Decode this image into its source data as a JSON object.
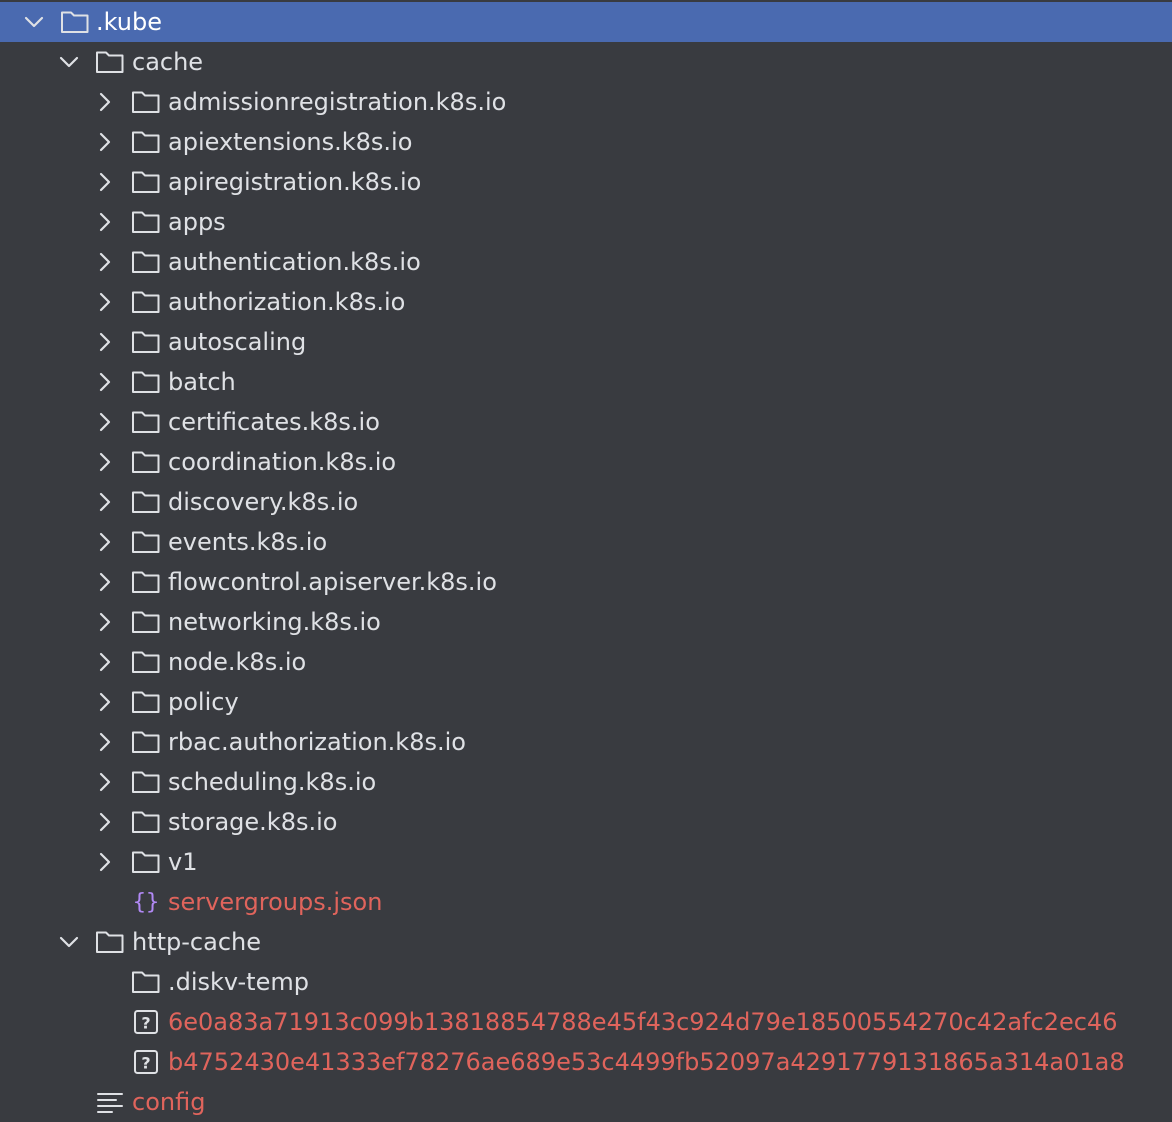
{
  "tree": {
    "root": {
      "label": ".kube",
      "expanded": true,
      "selected": true
    },
    "cache": {
      "label": "cache",
      "expanded": true,
      "folders": [
        "admissionregistration.k8s.io",
        "apiextensions.k8s.io",
        "apiregistration.k8s.io",
        "apps",
        "authentication.k8s.io",
        "authorization.k8s.io",
        "autoscaling",
        "batch",
        "certificates.k8s.io",
        "coordination.k8s.io",
        "discovery.k8s.io",
        "events.k8s.io",
        "flowcontrol.apiserver.k8s.io",
        "networking.k8s.io",
        "node.k8s.io",
        "policy",
        "rbac.authorization.k8s.io",
        "scheduling.k8s.io",
        "storage.k8s.io",
        "v1"
      ],
      "file": {
        "label": "servergroups.json",
        "icon": "json-braces-icon"
      }
    },
    "http_cache": {
      "label": "http-cache",
      "expanded": true,
      "folder": ".diskv-temp",
      "files": [
        "6e0a83a71913c099b13818854788e45f43c924d79e18500554270c42afc2ec46",
        "b4752430e41333ef78276ae689e53c4499fb52097a4291779131865a314a01a8"
      ]
    },
    "config": {
      "label": "config",
      "icon": "text-lines-icon"
    }
  },
  "colors": {
    "background": "#393b40",
    "selection": "#4a6ab0",
    "text": "#dfe1e5",
    "unversioned_text": "#e0645c",
    "json_icon": "#b189f5"
  }
}
